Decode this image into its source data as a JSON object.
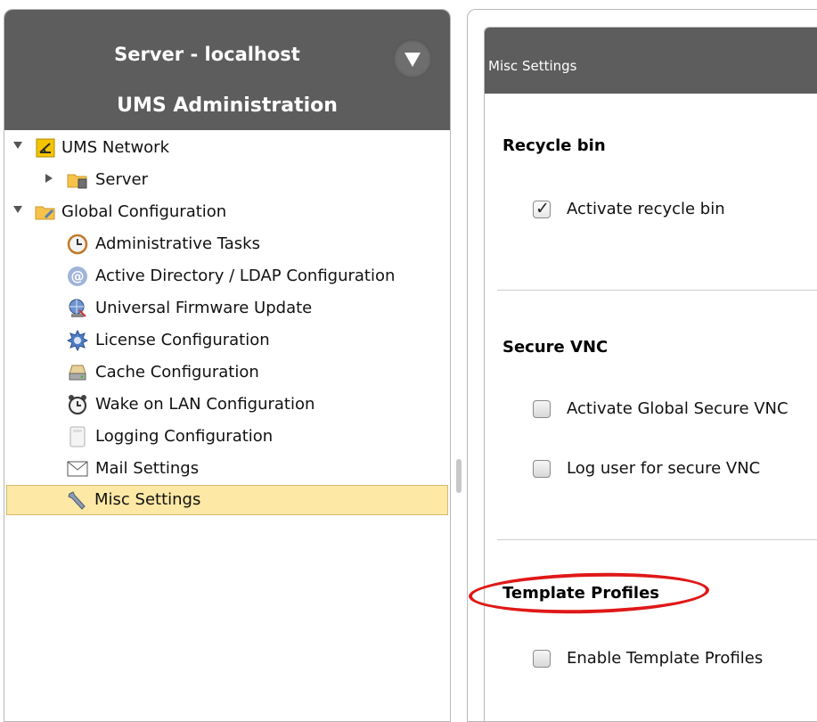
{
  "left": {
    "server_title": "Server - localhost",
    "admin_title": "UMS Administration",
    "tree": [
      {
        "label": "UMS Network",
        "icon": "network-icon",
        "expanded": true,
        "selected": false
      },
      {
        "label": "Server",
        "icon": "server-folder-icon",
        "expanded": false,
        "selected": false
      },
      {
        "label": "Global Configuration",
        "icon": "config-folder-icon",
        "expanded": true,
        "selected": false
      },
      {
        "label": "Administrative Tasks",
        "icon": "clock-icon",
        "selected": false
      },
      {
        "label": "Active Directory / LDAP Configuration",
        "icon": "at-icon",
        "selected": false
      },
      {
        "label": "Universal Firmware Update",
        "icon": "globe-update-icon",
        "selected": false
      },
      {
        "label": "License Configuration",
        "icon": "license-badge-icon",
        "selected": false
      },
      {
        "label": "Cache Configuration",
        "icon": "cache-drive-icon",
        "selected": false
      },
      {
        "label": "Wake on LAN Configuration",
        "icon": "alarm-clock-icon",
        "selected": false
      },
      {
        "label": "Logging Configuration",
        "icon": "log-document-icon",
        "selected": false
      },
      {
        "label": "Mail Settings",
        "icon": "envelope-icon",
        "selected": false
      },
      {
        "label": "Misc Settings",
        "icon": "wrench-icon",
        "selected": true
      }
    ]
  },
  "right": {
    "header_title": "Misc Settings",
    "sections": [
      {
        "title": "Recycle bin",
        "options": [
          {
            "label": "Activate recycle bin",
            "checked": true
          }
        ]
      },
      {
        "title": "Secure VNC",
        "options": [
          {
            "label": "Activate Global Secure VNC",
            "checked": false
          },
          {
            "label": "Log user for secure VNC",
            "checked": false
          }
        ]
      },
      {
        "title": "Template Profiles",
        "options": [
          {
            "label": "Enable Template Profiles",
            "checked": false
          }
        ]
      }
    ]
  },
  "colors": {
    "header_bg": "#5d5d5d",
    "selected_row": "#fde8a6",
    "highlight_ellipse": "#e01818"
  }
}
